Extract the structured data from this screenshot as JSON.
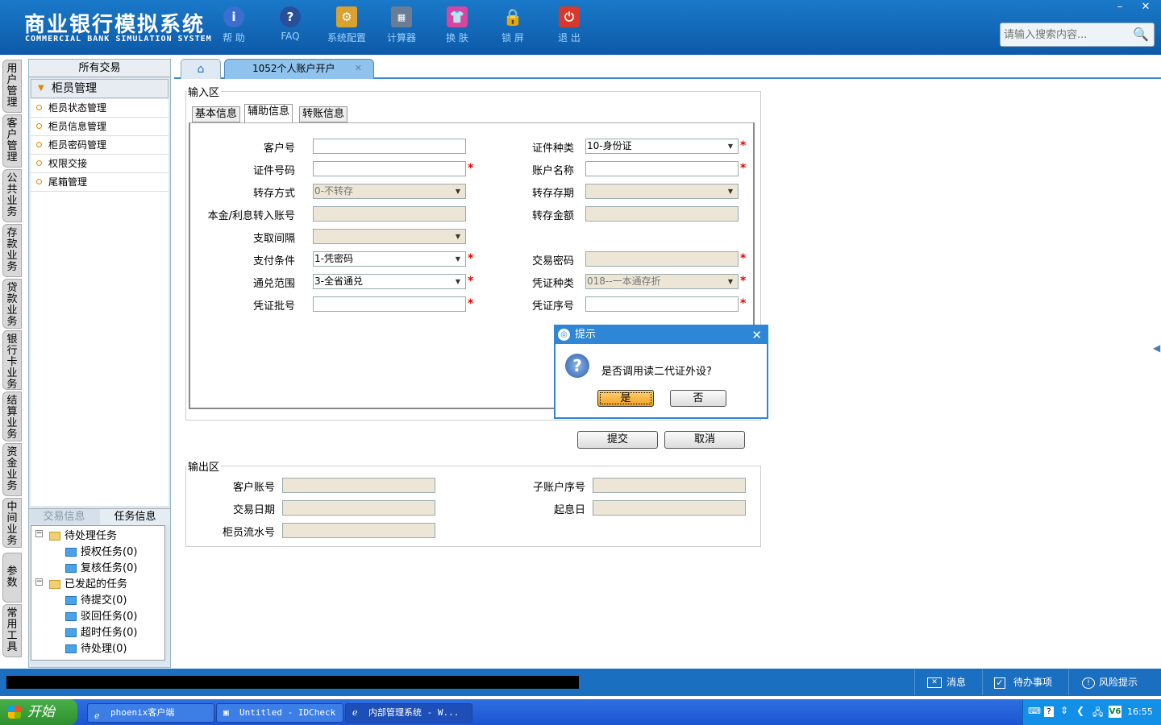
{
  "header": {
    "title_cn": "商业银行模拟系统",
    "title_en": "COMMERCIAL BANK SIMULATION SYSTEM",
    "tools": [
      {
        "label": "帮 助",
        "icon": "help-icon"
      },
      {
        "label": "FAQ",
        "icon": "faq-icon"
      },
      {
        "label": "系统配置",
        "icon": "config-icon"
      },
      {
        "label": "计算器",
        "icon": "calculator-icon"
      },
      {
        "label": "换 肤",
        "icon": "skin-icon"
      },
      {
        "label": "锁 屏",
        "icon": "lock-icon"
      },
      {
        "label": "退 出",
        "icon": "power-icon"
      }
    ],
    "search_placeholder": "请输入搜索内容..."
  },
  "side_tabs": [
    "用户管理",
    "客户管理",
    "公共业务",
    "存款业务",
    "贷款业务",
    "银行卡业务",
    "结算业务",
    "资金业务",
    "中间业务",
    "参数",
    "常用工具"
  ],
  "nav": {
    "header": "所有交易",
    "group": "柜员管理",
    "items": [
      "柜员状态管理",
      "柜员信息管理",
      "柜员密码管理",
      "权限交接",
      "尾箱管理"
    ]
  },
  "task_panel": {
    "tabs": [
      "交易信息",
      "任务信息"
    ],
    "tree": {
      "pending": "待处理任务",
      "pending_children": [
        "授权任务(0)",
        "复核任务(0)"
      ],
      "initiated": "已发起的任务",
      "initiated_children": [
        "待提交(0)",
        "驳回任务(0)",
        "超时任务(0)",
        "待处理(0)"
      ]
    }
  },
  "tabs": {
    "doc_tab": "1052个人账户开户"
  },
  "input_area": {
    "legend": "输入区",
    "subtabs": [
      "基本信息",
      "辅助信息",
      "转账信息"
    ],
    "fields": {
      "customer_no": {
        "label": "客户号",
        "value": ""
      },
      "id_type": {
        "label": "证件种类",
        "value": "10-身份证"
      },
      "id_no": {
        "label": "证件号码",
        "value": ""
      },
      "account_name": {
        "label": "账户名称",
        "value": ""
      },
      "transfer_mode": {
        "label": "转存方式",
        "value": "0-不转存"
      },
      "transfer_term": {
        "label": "转存存期",
        "value": ""
      },
      "principal_account": {
        "label": "本金/利息转入账号",
        "value": ""
      },
      "transfer_amount": {
        "label": "转存金额",
        "value": ""
      },
      "withdraw_interval": {
        "label": "支取间隔",
        "value": ""
      },
      "pay_condition": {
        "label": "支付条件",
        "value": "1-凭密码"
      },
      "trade_password": {
        "label": "交易密码",
        "value": ""
      },
      "exchange_scope": {
        "label": "通兑范围",
        "value": "3-全省通兑"
      },
      "voucher_type": {
        "label": "凭证种类",
        "value": "018--一本通存折"
      },
      "voucher_batch": {
        "label": "凭证批号",
        "value": ""
      },
      "voucher_seq": {
        "label": "凭证序号",
        "value": ""
      }
    },
    "required_mark": "*"
  },
  "actions": {
    "submit": "提交",
    "cancel": "取消"
  },
  "output_area": {
    "legend": "输出区",
    "fields": {
      "customer_account": "客户账号",
      "sub_account_seq": "子账户序号",
      "trade_date": "交易日期",
      "value_date": "起息日",
      "teller_serial": "柜员流水号"
    }
  },
  "dialog": {
    "title": "提示",
    "message": "是否调用读二代证外设?",
    "yes": "是",
    "no": "否"
  },
  "statusbar": {
    "messages": "消息",
    "todo": "待办事项",
    "risk": "风险提示"
  },
  "taskbar": {
    "start": "开始",
    "tasks": [
      "phoenix客户端",
      "Untitled - IDCheck",
      "内部管理系统 - W..."
    ],
    "clock": "16:55",
    "tray_label": "V6"
  }
}
